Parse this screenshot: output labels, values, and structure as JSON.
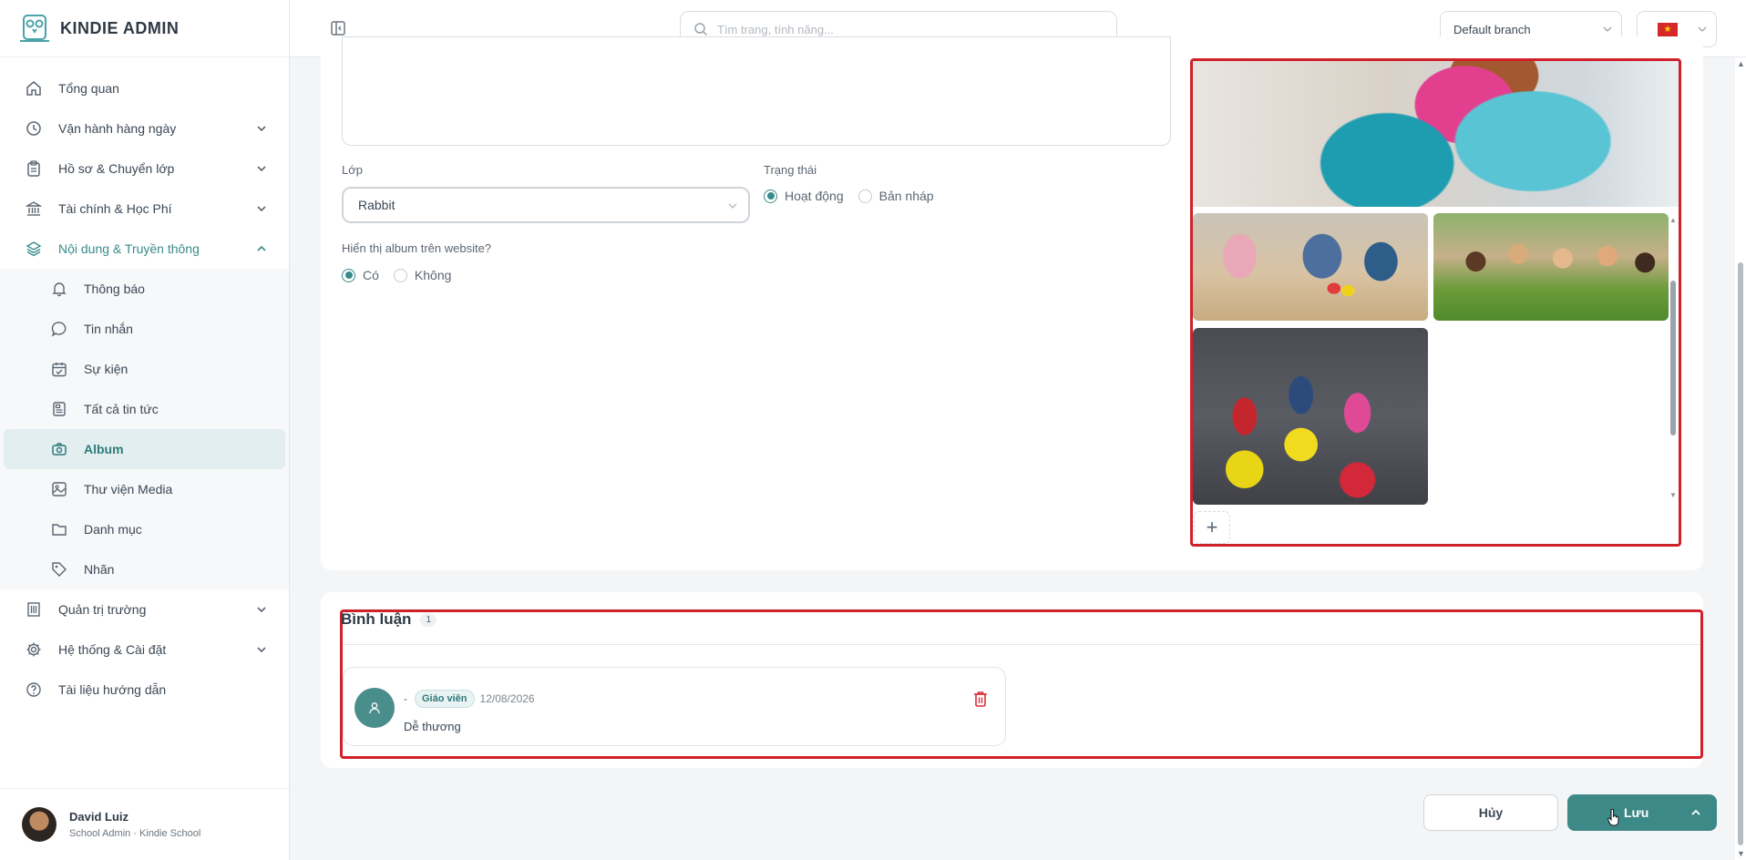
{
  "app": {
    "brand": "KINDIE ADMIN"
  },
  "sidebar": {
    "items": [
      {
        "label": "Tổng quan"
      },
      {
        "label": "Vận hành hàng ngày"
      },
      {
        "label": "Hồ sơ & Chuyển lớp"
      },
      {
        "label": "Tài chính & Học Phí"
      },
      {
        "label": "Nội dung & Truyền thông"
      }
    ],
    "sub_items": [
      {
        "label": "Thông báo"
      },
      {
        "label": "Tin nhắn"
      },
      {
        "label": "Sự kiện"
      },
      {
        "label": "Tất cả tin tức"
      },
      {
        "label": "Album"
      },
      {
        "label": "Thư viện Media"
      },
      {
        "label": "Danh mục"
      },
      {
        "label": "Nhãn"
      }
    ],
    "bottom_items": [
      {
        "label": "Quản trị trường"
      },
      {
        "label": "Hệ thống & Cài đặt"
      },
      {
        "label": "Tài liệu hướng dẫn"
      }
    ],
    "user": {
      "name": "David Luiz",
      "role": "School Admin · Kindie School"
    }
  },
  "topbar": {
    "search_placeholder": "Tìm trang, tính năng...",
    "branch": "Default branch",
    "flag_star": "★"
  },
  "form": {
    "class_label": "Lớp",
    "class_value": "Rabbit",
    "status_label": "Trạng thái",
    "status_options": [
      "Hoạt động",
      "Bản nháp"
    ],
    "status_selected": "Hoạt động",
    "website_label": "Hiển thị album trên website?",
    "website_options": [
      "Có",
      "Không"
    ],
    "website_selected": "Có"
  },
  "gallery": {
    "add_symbol": "+"
  },
  "comments": {
    "title": "Bình luận",
    "count": "1",
    "items": [
      {
        "author": "-",
        "role": "Giáo viên",
        "date": "12/08/2026",
        "text": "Dễ thương"
      }
    ]
  },
  "actions": {
    "cancel": "Hủy",
    "save": "Lưu"
  },
  "colors": {
    "accent": "#3d8987",
    "highlight": "#d0202a",
    "active_bg": "#e3eef0"
  }
}
